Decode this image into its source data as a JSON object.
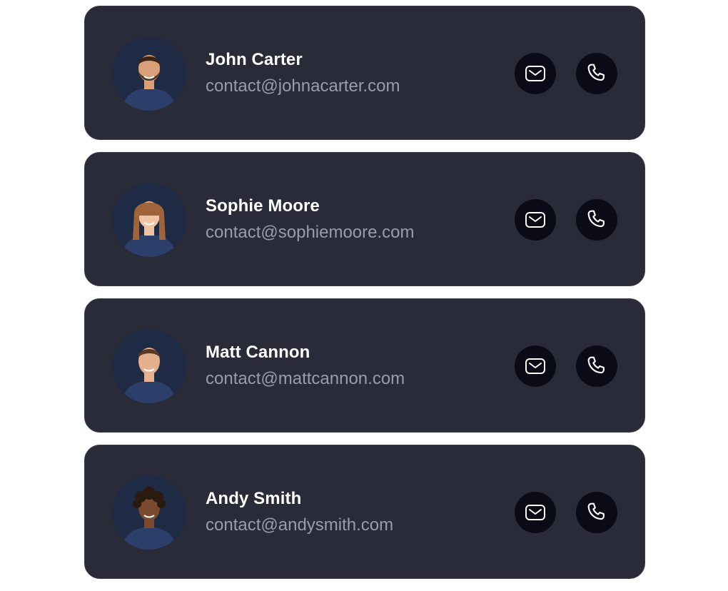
{
  "contacts": [
    {
      "name": "John Carter",
      "email": "contact@johnacarter.com",
      "skin": "#d9a07a",
      "hair": "#3a2418",
      "beard": true,
      "long_hair": false
    },
    {
      "name": "Sophie Moore",
      "email": "contact@sophiemoore.com",
      "skin": "#f0c3a2",
      "hair": "#a0643a",
      "beard": false,
      "long_hair": true
    },
    {
      "name": "Matt Cannon",
      "email": "contact@mattcannon.com",
      "skin": "#e5b08d",
      "hair": "#5a3a22",
      "beard": false,
      "long_hair": false
    },
    {
      "name": "Andy Smith",
      "email": "contact@andysmith.com",
      "skin": "#7a4a2e",
      "hair": "#2a1a10",
      "beard": false,
      "long_hair": false,
      "curly": true
    }
  ],
  "icons": {
    "mail": "mail-icon",
    "phone": "phone-icon"
  },
  "colors": {
    "card_bg": "#2a2b39",
    "name": "#ffffff",
    "email": "#9b9cab",
    "button_bg": "#0b0b18",
    "avatar_bg": "#1f2a45",
    "shirt": "#2c3f6b"
  }
}
